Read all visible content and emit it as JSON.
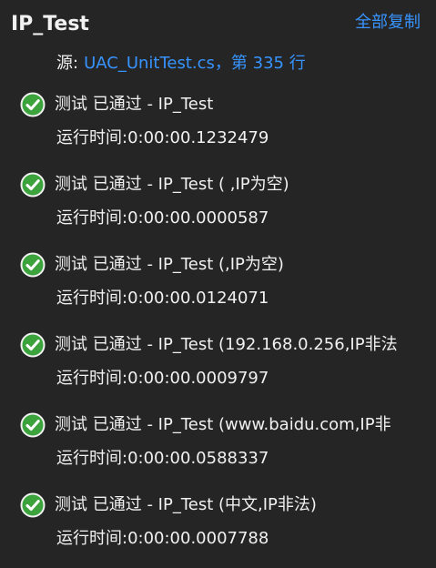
{
  "header": {
    "title": "IP_Test",
    "copy_all_label": "全部复制"
  },
  "source": {
    "label": "源:",
    "link_text": "UAC_UnitTest.cs，第 335 行"
  },
  "colors": {
    "background": "#252526",
    "text": "#f1f1f1",
    "link": "#3794ff",
    "pass_green": "#3ca33c"
  },
  "icons": {
    "pass": "check-circle-icon"
  },
  "results": [
    {
      "status_text": "测试 已通过 - IP_Test",
      "duration": "运行时间:0:00:00.1232479"
    },
    {
      "status_text": "测试 已通过 - IP_Test ( ,IP为空)",
      "duration": "运行时间:0:00:00.0000587"
    },
    {
      "status_text": "测试 已通过 - IP_Test (,IP为空)",
      "duration": "运行时间:0:00:00.0124071"
    },
    {
      "status_text": "测试 已通过 - IP_Test (192.168.0.256,IP非法",
      "duration": "运行时间:0:00:00.0009797"
    },
    {
      "status_text": "测试 已通过 - IP_Test (www.baidu.com,IP非",
      "duration": "运行时间:0:00:00.0588337"
    },
    {
      "status_text": "测试 已通过 - IP_Test (中文,IP非法)",
      "duration": "运行时间:0:00:00.0007788"
    }
  ]
}
